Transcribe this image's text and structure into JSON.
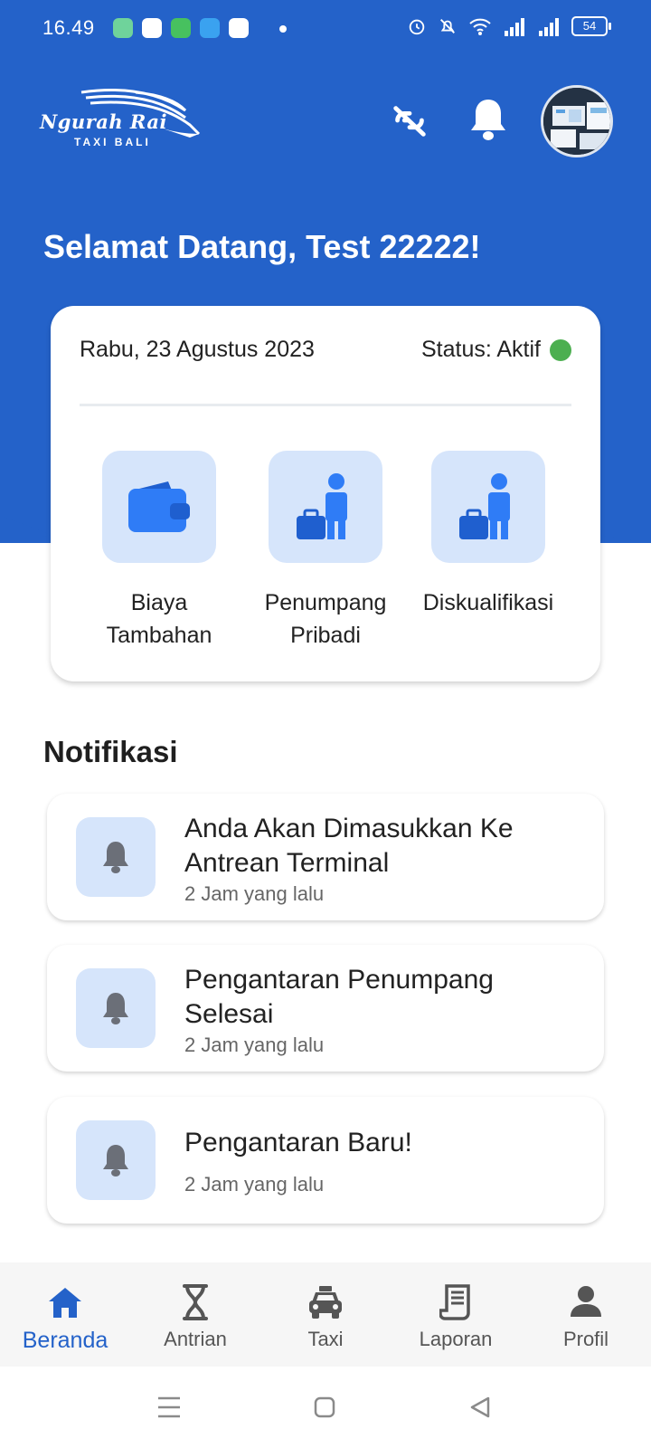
{
  "status_bar": {
    "time": "16.49",
    "battery": "54"
  },
  "header": {
    "logo_text": "Ngurah Rai",
    "logo_subtext": "TAXI BALI",
    "welcome": "Selamat Datang, Test 22222!"
  },
  "card": {
    "date": "Rabu, 23 Agustus 2023",
    "status": "Status: Aktif",
    "status_color": "#4caf50",
    "menu": [
      {
        "label": "Biaya Tambahan",
        "icon": "wallet-icon"
      },
      {
        "label": "Penumpang Pribadi",
        "icon": "passenger-luggage-icon"
      },
      {
        "label": "Diskualifikasi",
        "icon": "passenger-luggage-icon"
      }
    ]
  },
  "notifications": {
    "title": "Notifikasi",
    "items": [
      {
        "title": "Anda Akan Dimasukkan Ke Antrean Terminal",
        "time": "2 Jam yang lalu"
      },
      {
        "title": "Pengantaran Penumpang Selesai",
        "time": "2 Jam yang lalu"
      },
      {
        "title": "Pengantaran Baru!",
        "time": "2 Jam yang lalu"
      }
    ]
  },
  "bottom_nav": {
    "items": [
      {
        "label": "Beranda",
        "icon": "home-icon",
        "active": true
      },
      {
        "label": "Antrian",
        "icon": "hourglass-icon",
        "active": false
      },
      {
        "label": "Taxi",
        "icon": "taxi-icon",
        "active": false
      },
      {
        "label": "Laporan",
        "icon": "receipt-icon",
        "active": false
      },
      {
        "label": "Profil",
        "icon": "person-icon",
        "active": false
      }
    ]
  },
  "colors": {
    "primary": "#2462c9",
    "tile_bg": "#d6e5fb",
    "icon_blue": "#2f7cf6"
  }
}
